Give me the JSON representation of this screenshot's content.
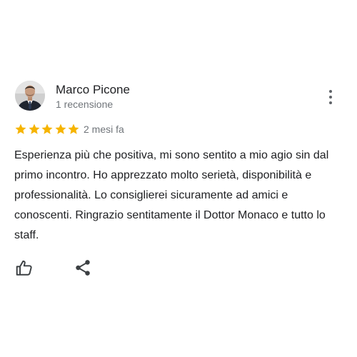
{
  "review": {
    "reviewer_name": "Marco Picone",
    "review_count": "1 recensione",
    "rating": 5,
    "rating_max": 5,
    "time": "2 mesi fa",
    "text": "Esperienza più che positiva, mi sono sentito a mio agio sin dal primo incontro. Ho apprezzato molto serietà, disponibilità e professionalità. Lo consiglierei sicuramente ad amici e conoscenti. Ringrazio sentitamente il Dottor Monaco e tutto lo staff."
  },
  "icons": {
    "more": "more-vert-icon",
    "star": "star-icon",
    "like": "thumb-up-icon",
    "share": "share-icon"
  },
  "colors": {
    "star": "#f6b400",
    "name": "#202124",
    "secondary": "#70757a",
    "icon": "#3c4043"
  }
}
